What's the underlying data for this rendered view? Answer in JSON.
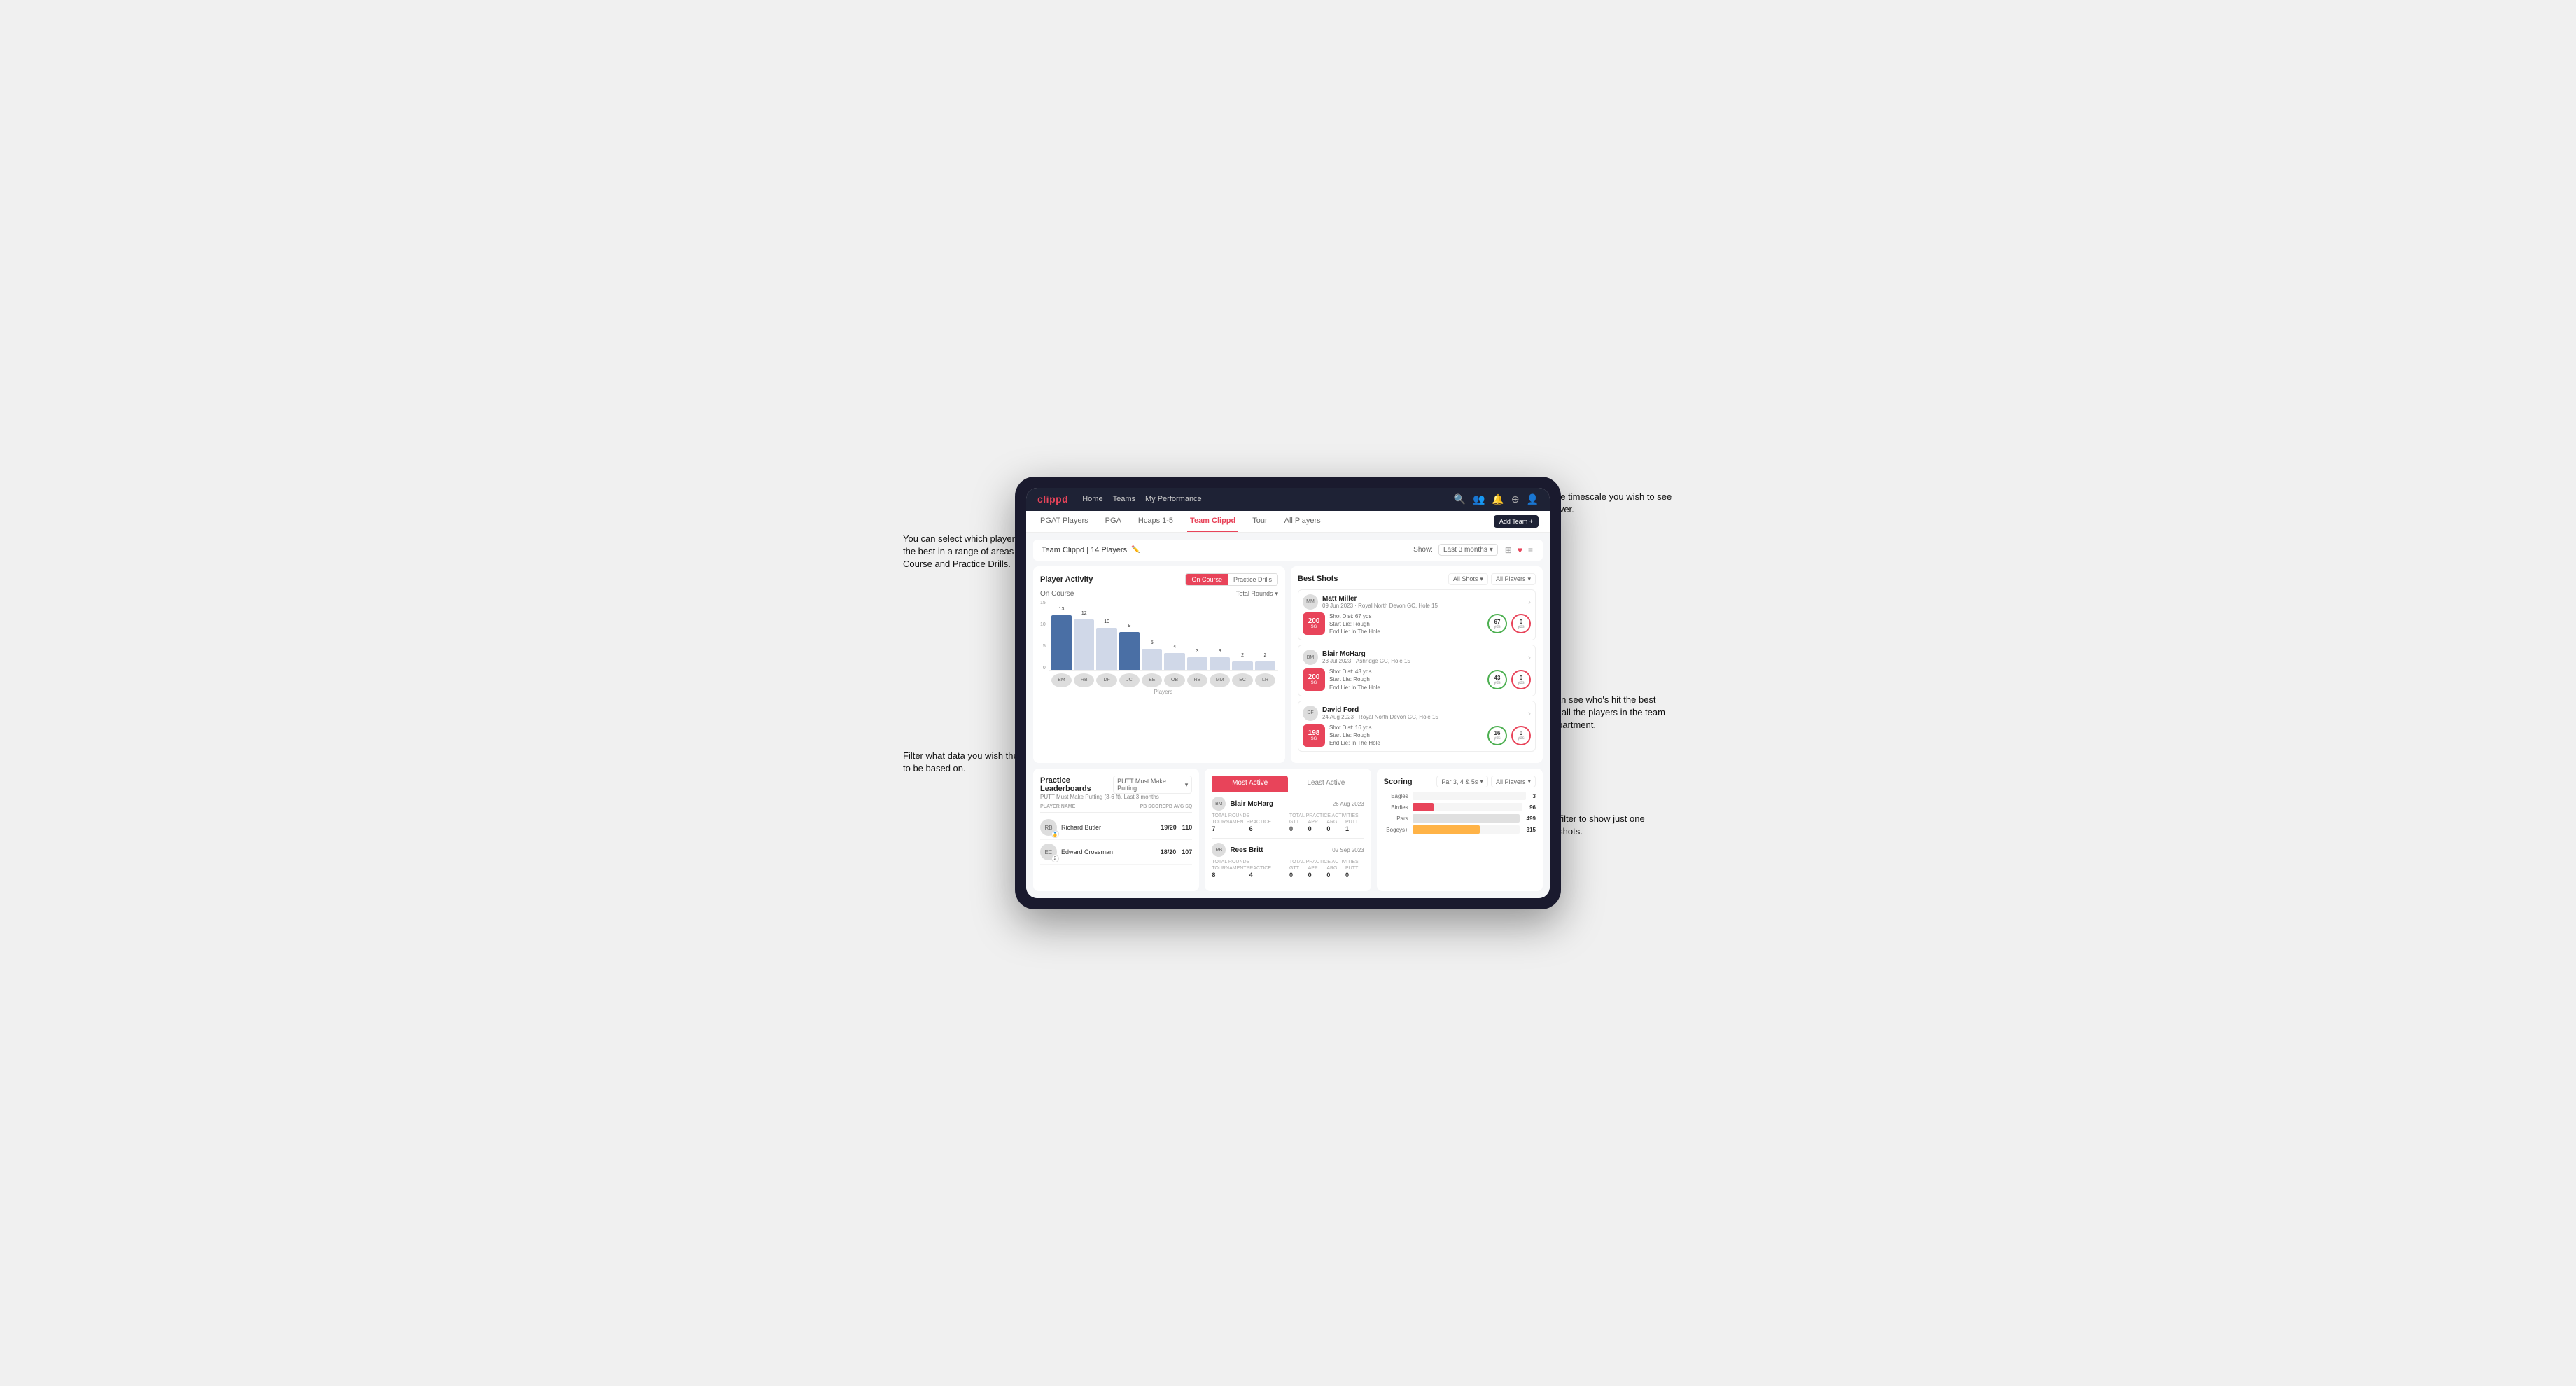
{
  "annotations": {
    "topleft": "You can select which player is doing the best in a range of areas for both On Course and Practice Drills.",
    "bottomleft": "Filter what data you wish the table to be based on.",
    "topright": "Choose the timescale you wish to see the data over.",
    "midright": "Here you can see who's hit the best shots out of all the players in the team for each department.",
    "bottomright": "You can also filter to show just one player's best shots."
  },
  "nav": {
    "logo": "clippd",
    "links": [
      "Home",
      "Teams",
      "My Performance"
    ],
    "icons": [
      "search",
      "people",
      "bell",
      "plus",
      "user"
    ]
  },
  "subtabs": [
    "PGAT Players",
    "PGA",
    "Hcaps 1-5",
    "Team Clippd",
    "Tour",
    "All Players"
  ],
  "active_subtab": "Team Clippd",
  "add_team_btn": "Add Team +",
  "team_header": {
    "title": "Team Clippd | 14 Players",
    "show_label": "Show:",
    "filter": "Last 3 months",
    "view_options": [
      "grid",
      "heart",
      "list"
    ]
  },
  "player_activity": {
    "title": "Player Activity",
    "toggle": [
      "On Course",
      "Practice Drills"
    ],
    "active_toggle": "On Course",
    "section_label": "On Course",
    "chart_filter": "Total Rounds",
    "bars": [
      {
        "label": "B. McHarg",
        "value": 13,
        "height": 90,
        "highlight": true
      },
      {
        "label": "R. Britt",
        "value": 12,
        "height": 83
      },
      {
        "label": "D. Ford",
        "value": 10,
        "height": 69
      },
      {
        "label": "J. Coles",
        "value": 9,
        "height": 62,
        "highlight": true
      },
      {
        "label": "E. Ebert",
        "value": 5,
        "height": 35
      },
      {
        "label": "O. Billingham",
        "value": 4,
        "height": 28
      },
      {
        "label": "R. Butler",
        "value": 3,
        "height": 21
      },
      {
        "label": "M. Miller",
        "value": 3,
        "height": 21
      },
      {
        "label": "E. Crossman",
        "value": 2,
        "height": 14
      },
      {
        "label": "L. Robertson",
        "value": 2,
        "height": 14
      }
    ],
    "y_labels": [
      "15",
      "10",
      "5",
      "0"
    ],
    "x_axis_label": "Players"
  },
  "best_shots": {
    "title": "Best Shots",
    "toggles": [
      "All Shots",
      "All Players"
    ],
    "players": [
      {
        "name": "Matt Miller",
        "date": "09 Jun 2023",
        "course": "Royal North Devon GC",
        "hole": "Hole 15",
        "badge_value": "200",
        "badge_sub": "SG",
        "shot_desc": "Shot Dist: 67 yds\nStart Lie: Rough\nEnd Lie: In The Hole",
        "stat1_value": "67",
        "stat1_sub": "yds",
        "stat2_value": "0",
        "stat2_sub": "yds"
      },
      {
        "name": "Blair McHarg",
        "date": "23 Jul 2023",
        "course": "Ashridge GC",
        "hole": "Hole 15",
        "badge_value": "200",
        "badge_sub": "SG",
        "shot_desc": "Shot Dist: 43 yds\nStart Lie: Rough\nEnd Lie: In The Hole",
        "stat1_value": "43",
        "stat1_sub": "yds",
        "stat2_value": "0",
        "stat2_sub": "yds"
      },
      {
        "name": "David Ford",
        "date": "24 Aug 2023",
        "course": "Royal North Devon GC",
        "hole": "Hole 15",
        "badge_value": "198",
        "badge_sub": "SG",
        "shot_desc": "Shot Dist: 16 yds\nStart Lie: Rough\nEnd Lie: In The Hole",
        "stat1_value": "16",
        "stat1_sub": "yds",
        "stat2_value": "0",
        "stat2_sub": "yds"
      }
    ]
  },
  "leaderboard": {
    "title": "Practice Leaderboards",
    "dropdown": "PUTT Must Make Putting...",
    "subtitle": "PUTT Must Make Putting (3-6 ft), Last 3 months",
    "col_player": "PLAYER NAME",
    "col_pb": "PB SCORE",
    "col_avg": "PB AVG SQ",
    "rows": [
      {
        "name": "Richard Butler",
        "rank": "1",
        "pb": "19/20",
        "avg": "110"
      },
      {
        "name": "Edward Crossman",
        "rank": "2",
        "pb": "18/20",
        "avg": "107"
      }
    ]
  },
  "most_active": {
    "title": "Most Active",
    "tabs": [
      "Most Active",
      "Least Active"
    ],
    "active_tab": "Most Active",
    "players": [
      {
        "name": "Blair McHarg",
        "date": "26 Aug 2023",
        "total_rounds_label": "Total Rounds",
        "tournament_label": "Tournament",
        "practice_label": "Practice",
        "tournament_val": "7",
        "practice_val": "6",
        "practice_activities_label": "Total Practice Activities",
        "gtt_label": "GTT",
        "app_label": "APP",
        "arg_label": "ARG",
        "putt_label": "PUTT",
        "gtt_val": "0",
        "app_val": "0",
        "arg_val": "0",
        "putt_val": "1"
      },
      {
        "name": "Rees Britt",
        "date": "02 Sep 2023",
        "tournament_val": "8",
        "practice_val": "4",
        "gtt_val": "0",
        "app_val": "0",
        "arg_val": "0",
        "putt_val": "0"
      }
    ]
  },
  "scoring": {
    "title": "Scoring",
    "filter1": "Par 3, 4 & 5s",
    "filter2": "All Players",
    "bars": [
      {
        "label": "Eagles",
        "value": 3,
        "percent": 2,
        "color": "#4a6fa5"
      },
      {
        "label": "Birdies",
        "value": 96,
        "percent": 20,
        "color": "#e8445a"
      },
      {
        "label": "Pars",
        "value": 499,
        "percent": 100,
        "color": "#e0e0e0"
      },
      {
        "label": "Bogeys+",
        "value": 315,
        "percent": 65,
        "color": "#ffb347"
      }
    ]
  }
}
